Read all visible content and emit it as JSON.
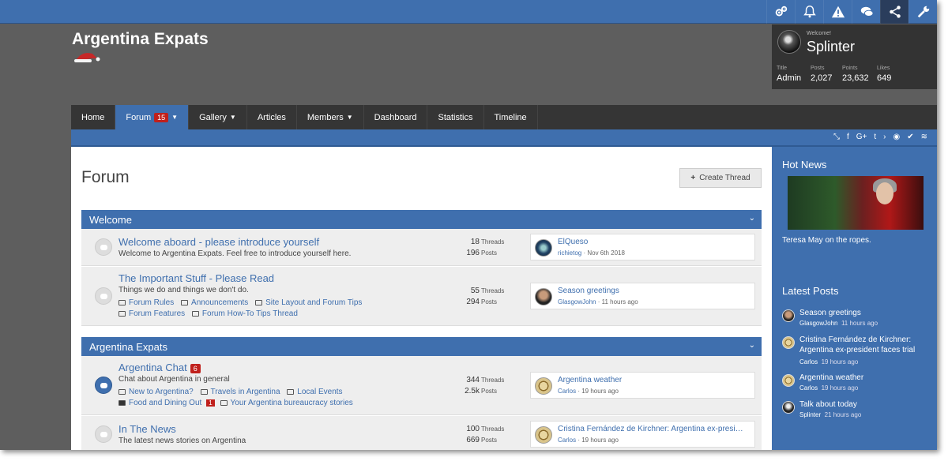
{
  "site": {
    "logo": "Argentina Expats"
  },
  "topbar": {
    "icons": [
      "settings-icon",
      "bell-icon",
      "alert-icon",
      "chat-icon",
      "share-icon",
      "wrench-icon"
    ]
  },
  "user_panel": {
    "welcome": "Welcome!",
    "username": "Splinter",
    "stats": [
      {
        "label": "Title",
        "value": "Admin"
      },
      {
        "label": "Posts",
        "value": "2,027"
      },
      {
        "label": "Points",
        "value": "23,632"
      },
      {
        "label": "Likes",
        "value": "649"
      }
    ]
  },
  "nav": {
    "tabs": [
      {
        "label": "Home"
      },
      {
        "label": "Forum",
        "badge": "15"
      },
      {
        "label": "Gallery"
      },
      {
        "label": "Articles"
      },
      {
        "label": "Members"
      },
      {
        "label": "Dashboard"
      },
      {
        "label": "Statistics"
      },
      {
        "label": "Timeline"
      }
    ]
  },
  "main": {
    "title": "Forum",
    "create_thread": "Create Thread",
    "categories": [
      {
        "title": "Welcome"
      },
      {
        "title": "Argentina Expats"
      }
    ],
    "nodes": [
      {
        "title": "Welcome aboard - please introduce yourself",
        "description": "Welcome to Argentina Expats. Feel free to introduce yourself here.",
        "threads": "18",
        "posts": "196",
        "last_title": "ElQueso",
        "last_user": "richietog",
        "last_date": "Nov 6th 2018"
      },
      {
        "title": "The Important Stuff - Please Read",
        "description": "Things we do and things we don't do.",
        "subforums": [
          "Forum Rules",
          "Announcements",
          "Site Layout and Forum Tips",
          "Forum Features",
          "Forum How-To Tips Thread"
        ],
        "threads": "55",
        "posts": "294",
        "last_title": "Season greetings",
        "last_user": "GlasgowJohn",
        "last_date": "11 hours ago"
      },
      {
        "title": "Argentina Chat",
        "badge": "6",
        "description": "Chat about Argentina in general",
        "subforums": [
          "New to Argentina?",
          "Travels in Argentina",
          "Local Events",
          "Food and Dining Out",
          "Your Argentina bureaucracy stories"
        ],
        "subforum_badge": "1",
        "threads": "344",
        "posts": "2.5k",
        "last_title": "Argentina weather",
        "last_user": "Carlos",
        "last_date": "19 hours ago"
      },
      {
        "title": "In The News",
        "description": "The latest news stories on Argentina",
        "threads": "100",
        "posts": "669",
        "last_title": "Cristina Fernández de Kirchner: Argentina ex-president faces trial",
        "last_user": "Carlos",
        "last_date": "19 hours ago"
      }
    ],
    "labels": {
      "threads": "Threads",
      "posts": "Posts"
    }
  },
  "sidebar": {
    "hot_news": {
      "heading": "Hot News",
      "caption": "Teresa May on the ropes."
    },
    "latest_posts": {
      "heading": "Latest Posts",
      "items": [
        {
          "title": "Season greetings",
          "user": "GlasgowJohn",
          "time": "11 hours ago"
        },
        {
          "title": "Cristina Fernández de Kirchner: Argentina ex-president faces trial",
          "user": "Carlos",
          "time": "19 hours ago"
        },
        {
          "title": "Argentina weather",
          "user": "Carlos",
          "time": "19 hours ago"
        },
        {
          "title": "Talk about today",
          "user": "Splinter",
          "time": "21 hours ago"
        }
      ]
    }
  },
  "colors": {
    "brand": "#3f6fae",
    "nav_bg": "#353535",
    "header_bg": "#5e5e5e",
    "badge": "#c0201c"
  }
}
